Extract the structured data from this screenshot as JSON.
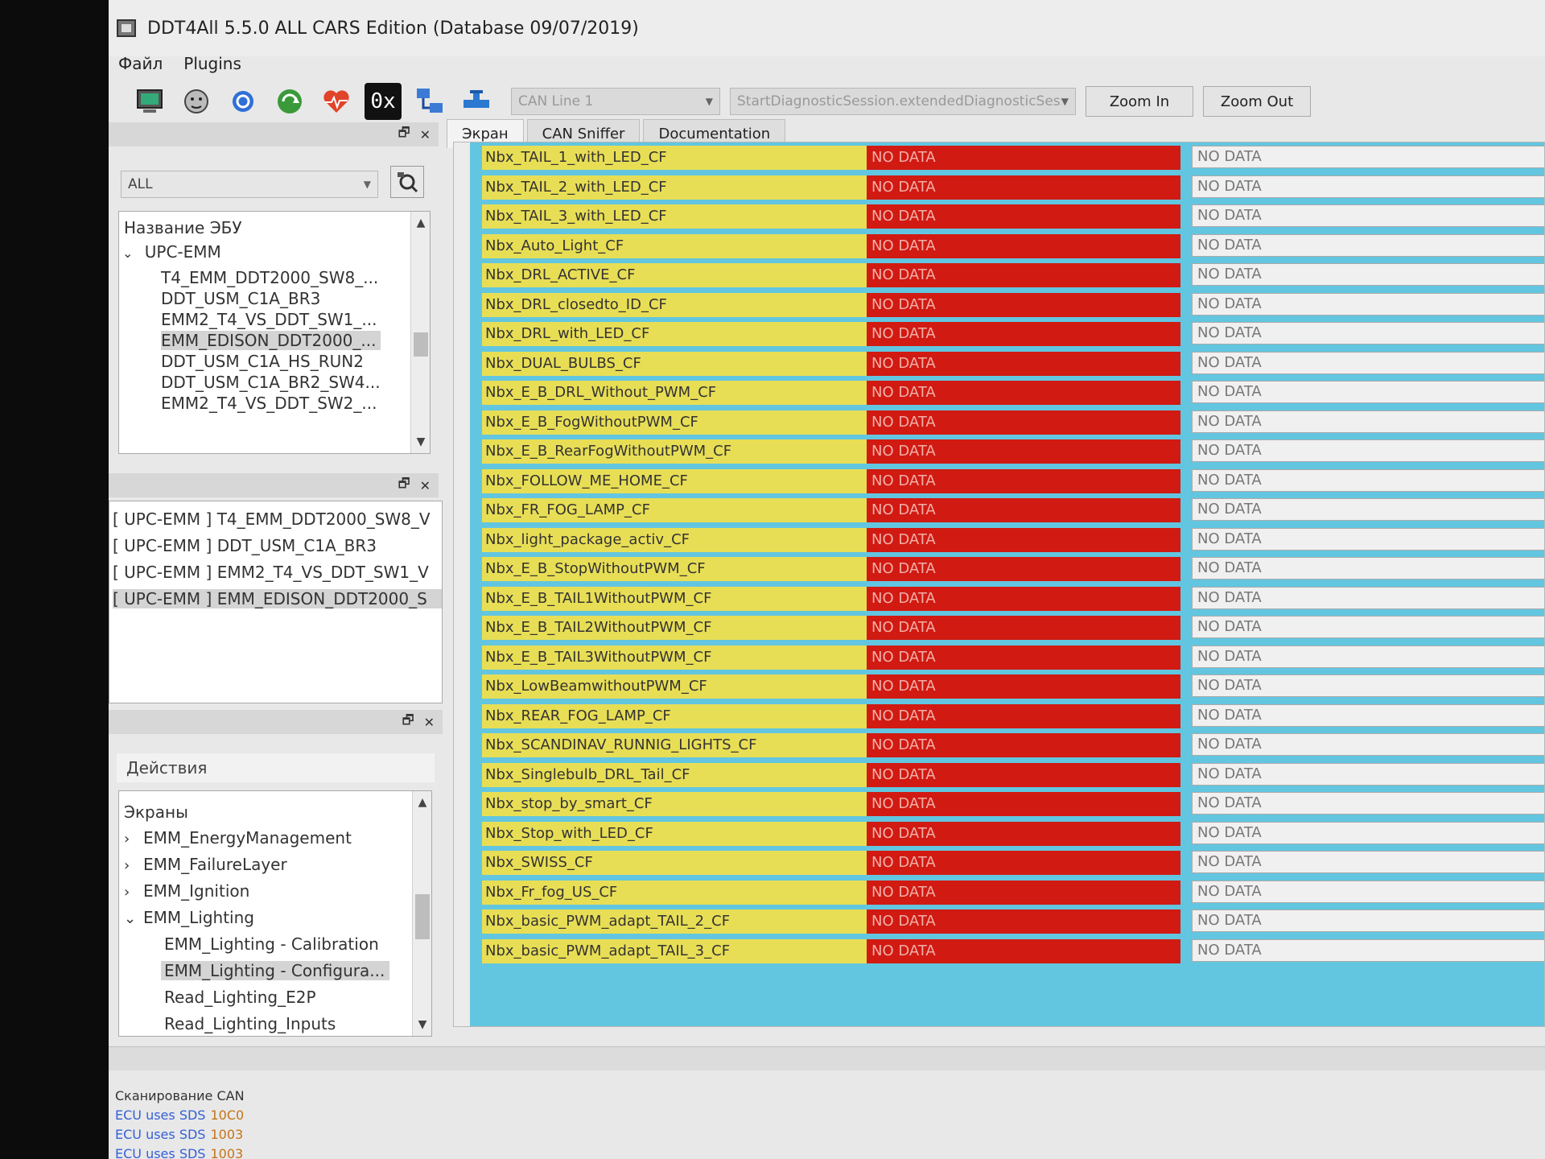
{
  "window": {
    "title": "DDT4All 5.5.0 ALL CARS Edition (Database 09/07/2019)"
  },
  "menu": [
    "Файл",
    "Plugins"
  ],
  "toolbar": {
    "icons": [
      "monitor-icon",
      "dog-icon",
      "refresh-icon",
      "sync-icon",
      "heartbeat-icon",
      "hex-icon",
      "network-icon",
      "pipe-icon"
    ],
    "hex_label": "0x",
    "can_line": "CAN Line 1",
    "session": "StartDiagnosticSession.extendedDiagnosticSessi",
    "zoom_in": "Zoom In",
    "zoom_out": "Zoom Out"
  },
  "ecu_panel": {
    "filter": "ALL",
    "header": "Название ЭБУ",
    "group": "UPC-EMM",
    "items": [
      "T4_EMM_DDT2000_SW8_...",
      "DDT_USM_C1A_BR3",
      "EMM2_T4_VS_DDT_SW1_...",
      "EMM_EDISON_DDT2000_...",
      "DDT_USM_C1A_HS_RUN2",
      "DDT_USM_C1A_BR2_SW4...",
      "EMM2_T4_VS_DDT_SW2_..."
    ],
    "selected_index": 3
  },
  "loaded_panel": {
    "items": [
      "[ UPC-EMM ] T4_EMM_DDT2000_SW8_V",
      "[ UPC-EMM ] DDT_USM_C1A_BR3",
      "[ UPC-EMM ] EMM2_T4_VS_DDT_SW1_V",
      "[ UPC-EMM ] EMM_EDISON_DDT2000_S"
    ],
    "selected_index": 3
  },
  "actions_panel": {
    "header": "Действия",
    "screens_label": "Экраны",
    "tree": [
      {
        "label": "EMM_EnergyManagement",
        "level": 0,
        "toggle": "›"
      },
      {
        "label": "EMM_FailureLayer",
        "level": 0,
        "toggle": "›"
      },
      {
        "label": "EMM_Ignition",
        "level": 0,
        "toggle": "›"
      },
      {
        "label": "EMM_Lighting",
        "level": 0,
        "toggle": "⌄"
      },
      {
        "label": "EMM_Lighting - Calibration",
        "level": 1,
        "toggle": ""
      },
      {
        "label": "EMM_Lighting - Configura...",
        "level": 1,
        "toggle": ""
      },
      {
        "label": "Read_Lighting_E2P",
        "level": 1,
        "toggle": ""
      },
      {
        "label": "Read_Lighting_Inputs",
        "level": 1,
        "toggle": ""
      }
    ],
    "selected_index": 5
  },
  "tabs": [
    "Экран",
    "CAN Sniffer",
    "Documentation"
  ],
  "params": [
    {
      "name": "Nbx_TAIL_1_with_LED_CF",
      "value": "NO DATA",
      "value2": "NO DATA"
    },
    {
      "name": "Nbx_TAIL_2_with_LED_CF",
      "value": "NO DATA",
      "value2": "NO DATA"
    },
    {
      "name": "Nbx_TAIL_3_with_LED_CF",
      "value": "NO DATA",
      "value2": "NO DATA"
    },
    {
      "name": "Nbx_Auto_Light_CF",
      "value": "NO DATA",
      "value2": "NO DATA"
    },
    {
      "name": "Nbx_DRL_ACTIVE_CF",
      "value": "NO DATA",
      "value2": "NO DATA"
    },
    {
      "name": "Nbx_DRL_closedto_ID_CF",
      "value": "NO DATA",
      "value2": "NO DATA"
    },
    {
      "name": "Nbx_DRL_with_LED_CF",
      "value": "NO DATA",
      "value2": "NO DATA"
    },
    {
      "name": "Nbx_DUAL_BULBS_CF",
      "value": "NO DATA",
      "value2": "NO DATA"
    },
    {
      "name": "Nbx_E_B_DRL_Without_PWM_CF",
      "value": "NO DATA",
      "value2": "NO DATA"
    },
    {
      "name": "Nbx_E_B_FogWithoutPWM_CF",
      "value": "NO DATA",
      "value2": "NO DATA"
    },
    {
      "name": "Nbx_E_B_RearFogWithoutPWM_CF",
      "value": "NO DATA",
      "value2": "NO DATA"
    },
    {
      "name": "Nbx_FOLLOW_ME_HOME_CF",
      "value": "NO DATA",
      "value2": "NO DATA"
    },
    {
      "name": "Nbx_FR_FOG_LAMP_CF",
      "value": "NO DATA",
      "value2": "NO DATA"
    },
    {
      "name": "Nbx_light_package_activ_CF",
      "value": "NO DATA",
      "value2": "NO DATA"
    },
    {
      "name": "Nbx_E_B_StopWithoutPWM_CF",
      "value": "NO DATA",
      "value2": "NO DATA"
    },
    {
      "name": "Nbx_E_B_TAIL1WithoutPWM_CF",
      "value": "NO DATA",
      "value2": "NO DATA"
    },
    {
      "name": "Nbx_E_B_TAIL2WithoutPWM_CF",
      "value": "NO DATA",
      "value2": "NO DATA"
    },
    {
      "name": "Nbx_E_B_TAIL3WithoutPWM_CF",
      "value": "NO DATA",
      "value2": "NO DATA"
    },
    {
      "name": "Nbx_LowBeamwithoutPWM_CF",
      "value": "NO DATA",
      "value2": "NO DATA"
    },
    {
      "name": "Nbx_REAR_FOG_LAMP_CF",
      "value": "NO DATA",
      "value2": "NO DATA"
    },
    {
      "name": "Nbx_SCANDINAV_RUNNIG_LIGHTS_CF",
      "value": "NO DATA",
      "value2": "NO DATA"
    },
    {
      "name": "Nbx_Singlebulb_DRL_Tail_CF",
      "value": "NO DATA",
      "value2": "NO DATA"
    },
    {
      "name": "Nbx_stop_by_smart_CF",
      "value": "NO DATA",
      "value2": "NO DATA"
    },
    {
      "name": "Nbx_Stop_with_LED_CF",
      "value": "NO DATA",
      "value2": "NO DATA"
    },
    {
      "name": "Nbx_SWISS_CF",
      "value": "NO DATA",
      "value2": "NO DATA"
    },
    {
      "name": "Nbx_Fr_fog_US_CF",
      "value": "NO DATA",
      "value2": "NO DATA"
    },
    {
      "name": "Nbx_basic_PWM_adapt_TAIL_2_CF",
      "value": "NO DATA",
      "value2": "NO DATA"
    },
    {
      "name": "Nbx_basic_PWM_adapt_TAIL_3_CF",
      "value": "NO DATA",
      "value2": "NO DATA"
    }
  ],
  "log": {
    "header": "Сканирование CAN",
    "lines": [
      {
        "text": "ECU uses SDS",
        "value": "10C0"
      },
      {
        "text": "ECU uses SDS",
        "value": "1003"
      },
      {
        "text": "ECU uses SDS",
        "value": "1003"
      }
    ]
  },
  "colors": {
    "param_name_bg": "#e8de55",
    "no_data_bg": "#d11a12",
    "screen_bg": "#62c6e0",
    "log_text": "#3561d6",
    "log_value": "#c4741a"
  }
}
